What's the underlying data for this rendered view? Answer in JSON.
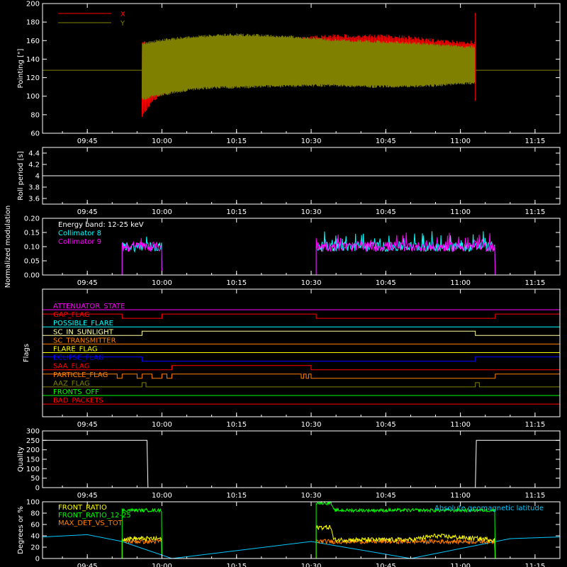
{
  "chart_data": {
    "type": "line",
    "x_ticks": [
      "09:45",
      "10:00",
      "10:15",
      "10:30",
      "10:45",
      "11:00",
      "11:15"
    ],
    "panels": [
      {
        "id": "pointing",
        "ylabel": "Pointing [\"]",
        "ylim": [
          60,
          200
        ],
        "yticks": [
          60,
          80,
          100,
          120,
          140,
          160,
          180,
          200
        ],
        "legend": [
          "X",
          "Y"
        ],
        "series": [
          {
            "name": "X",
            "color": "#ff0000"
          },
          {
            "name": "Y",
            "color": "#808000"
          }
        ],
        "baseline": 128,
        "active_window": [
          "09:56",
          "11:03"
        ],
        "x_envelope": {
          "t": [
            "09:56",
            "09:57",
            "09:58",
            "10:00",
            "10:05",
            "10:10",
            "10:15",
            "10:20",
            "10:25",
            "10:30",
            "10:35",
            "10:40",
            "10:45",
            "10:50",
            "10:55",
            "11:00",
            "11:03"
          ],
          "lo": [
            75,
            85,
            92,
            100,
            112,
            118,
            120,
            119,
            117,
            113,
            112,
            112,
            113,
            114,
            115,
            115,
            116
          ],
          "hi": [
            163,
            158,
            155,
            152,
            155,
            157,
            158,
            160,
            162,
            165,
            167,
            167,
            167,
            165,
            162,
            160,
            160
          ]
        },
        "y_envelope": {
          "t": [
            "09:56",
            "09:58",
            "10:00",
            "10:05",
            "10:10",
            "10:15",
            "10:20",
            "10:25",
            "10:30",
            "10:35",
            "10:40",
            "10:45",
            "10:50",
            "10:55",
            "11:00",
            "11:03"
          ],
          "lo": [
            95,
            98,
            100,
            105,
            108,
            108,
            109,
            109,
            110,
            110,
            109,
            109,
            109,
            110,
            112,
            113
          ],
          "hi": [
            158,
            160,
            162,
            165,
            167,
            168,
            167,
            166,
            164,
            162,
            161,
            160,
            159,
            157,
            155,
            155
          ]
        }
      },
      {
        "id": "roll",
        "ylabel": "Roll period [s]",
        "ylim": [
          3.5,
          4.5
        ],
        "yticks": [
          3.6,
          3.8,
          4.0,
          4.2,
          4.4
        ],
        "series": [
          {
            "name": "Roll period",
            "color": "#ffffff",
            "value": 4.0
          }
        ]
      },
      {
        "id": "modulation",
        "ylabel": "Normalized modulation",
        "ylim": [
          0,
          0.2
        ],
        "yticks": [
          0.0,
          0.05,
          0.1,
          0.15,
          0.2
        ],
        "yticklabels": [
          "0.00",
          "0.05",
          "0.10",
          "0.15",
          "0.20"
        ],
        "legend": [
          "Energy band: 12-25 keV",
          "Collimator 8",
          "Collimator 9"
        ],
        "series": [
          {
            "name": "Collimator 8",
            "color": "#00ffff",
            "mean": 0.1
          },
          {
            "name": "Collimator 9",
            "color": "#ff00ff",
            "mean": 0.1
          }
        ],
        "windows": [
          [
            "09:52",
            "10:00"
          ],
          [
            "10:31",
            "11:07"
          ]
        ]
      },
      {
        "id": "flags",
        "ylabel": "Flags",
        "flags": [
          {
            "name": "ATTENUATOR_STATE",
            "color": "#ff00ff",
            "steps": [
              [
                "09:36",
                0
              ],
              [
                "11:20",
                0
              ]
            ]
          },
          {
            "name": "GAP_FLAG",
            "color": "#ff0000",
            "steps": [
              [
                "09:36",
                1
              ],
              [
                "09:52",
                0
              ],
              [
                "10:00",
                1
              ],
              [
                "10:31",
                0
              ],
              [
                "11:07",
                1
              ],
              [
                "11:20",
                1
              ]
            ]
          },
          {
            "name": "POSSIBLE_FLARE",
            "color": "#00ffff",
            "steps": [
              [
                "09:36",
                0
              ],
              [
                "11:20",
                0
              ]
            ]
          },
          {
            "name": "SC_IN_SUNLIGHT",
            "color": "#ffffa0",
            "steps": [
              [
                "09:36",
                0
              ],
              [
                "09:56",
                1
              ],
              [
                "11:03",
                0
              ],
              [
                "11:20",
                0
              ]
            ]
          },
          {
            "name": "SC_TRANSMITTER",
            "color": "#ff8000",
            "steps": [
              [
                "09:36",
                0
              ],
              [
                "11:20",
                0
              ]
            ]
          },
          {
            "name": "FLARE_FLAG",
            "color": "#ffff00",
            "steps": [
              [
                "09:36",
                0
              ],
              [
                "11:20",
                0
              ]
            ]
          },
          {
            "name": "ECLIPSE_FLAG",
            "color": "#0000ff",
            "steps": [
              [
                "09:36",
                1
              ],
              [
                "09:56",
                0
              ],
              [
                "11:03",
                1
              ],
              [
                "11:20",
                1
              ]
            ]
          },
          {
            "name": "SAA_FLAG",
            "color": "#ff0000",
            "steps": [
              [
                "09:36",
                0
              ],
              [
                "10:02",
                1
              ],
              [
                "10:30",
                0
              ],
              [
                "11:20",
                0
              ]
            ]
          },
          {
            "name": "PARTICLE_FLAG",
            "color": "#ff8000",
            "steps": [
              [
                "09:36",
                1
              ],
              [
                "09:51",
                0
              ],
              [
                "09:52",
                1
              ],
              [
                "09:55",
                0
              ],
              [
                "09:56",
                1
              ],
              [
                "09:58",
                0
              ],
              [
                "10:00",
                1
              ],
              [
                "10:01",
                0
              ],
              [
                "10:02",
                1
              ],
              [
                "10:28",
                0
              ],
              [
                "10:28.5",
                1
              ],
              [
                "10:29",
                0
              ],
              [
                "10:29.5",
                1
              ],
              [
                "10:30",
                0
              ],
              [
                "11:07",
                1
              ],
              [
                "11:20",
                1
              ]
            ]
          },
          {
            "name": "AAZ_FLAG",
            "color": "#808000",
            "steps": [
              [
                "09:36",
                0
              ],
              [
                "09:56",
                1
              ],
              [
                "09:56.8",
                0
              ],
              [
                "11:03",
                1
              ],
              [
                "11:03.8",
                0
              ],
              [
                "11:20",
                0
              ]
            ]
          },
          {
            "name": "FRONTS_OFF",
            "color": "#00ff00",
            "steps": [
              [
                "09:36",
                0
              ],
              [
                "11:20",
                0
              ]
            ]
          },
          {
            "name": "BAD_PACKETS",
            "color": "#ff0000",
            "steps": [
              [
                "09:36",
                0
              ],
              [
                "11:20",
                0
              ]
            ]
          }
        ]
      },
      {
        "id": "quality",
        "ylabel": "Quality",
        "ylim": [
          0,
          300
        ],
        "yticks": [
          0,
          50,
          100,
          150,
          200,
          250,
          300
        ],
        "series": [
          {
            "name": "Quality",
            "color": "#ffffff",
            "x": [
              "09:36",
              "09:57",
              "09:57.2",
              "11:03",
              "11:03.2",
              "11:20"
            ],
            "y": [
              250,
              250,
              0,
              0,
              250,
              250
            ]
          }
        ]
      },
      {
        "id": "ratios",
        "ylabel": "Degrees or %",
        "ylim": [
          0,
          100
        ],
        "yticks": [
          0,
          20,
          40,
          60,
          80,
          100
        ],
        "legend": [
          "FRONT_RATIO",
          "FRONT_RATIO_12-25",
          "MAX_DET_VS_TOT",
          "Absolute geomagnetic latitude"
        ],
        "series": [
          {
            "name": "FRONT_RATIO",
            "color": "#ffff00",
            "windows": [
              {
                "t": [
                  "09:52",
                  "10:00"
                ],
                "y": [
                  35,
                  35
                ]
              },
              {
                "t": [
                  "10:31",
                  "10:34",
                  "10:34.5",
                  "10:50",
                  "10:55",
                  "11:07"
                ],
                "y": [
                  55,
                  55,
                  33,
                  33,
                  40,
                  33
                ]
              }
            ]
          },
          {
            "name": "FRONT_RATIO_12-25",
            "color": "#00ff00",
            "windows": [
              {
                "t": [
                  "09:52",
                  "10:00"
                ],
                "y": [
                  85,
                  85
                ]
              },
              {
                "t": [
                  "10:31",
                  "10:34",
                  "10:34.5",
                  "11:07"
                ],
                "y": [
                  98,
                  98,
                  85,
                  85
                ]
              }
            ]
          },
          {
            "name": "MAX_DET_VS_TOT",
            "color": "#ff8000",
            "windows": [
              {
                "t": [
                  "09:52",
                  "10:00"
                ],
                "y": [
                  30,
                  30
                ]
              },
              {
                "t": [
                  "10:31",
                  "11:07"
                ],
                "y": [
                  30,
                  30
                ]
              }
            ]
          },
          {
            "name": "Absolute geomagnetic latitude",
            "color": "#00c8ff",
            "x": [
              "09:36",
              "09:45",
              "09:52",
              "10:02",
              "10:30",
              "10:50",
              "11:10",
              "11:20"
            ],
            "y": [
              38,
              42,
              30,
              0,
              30,
              0,
              35,
              38
            ]
          }
        ]
      }
    ]
  }
}
